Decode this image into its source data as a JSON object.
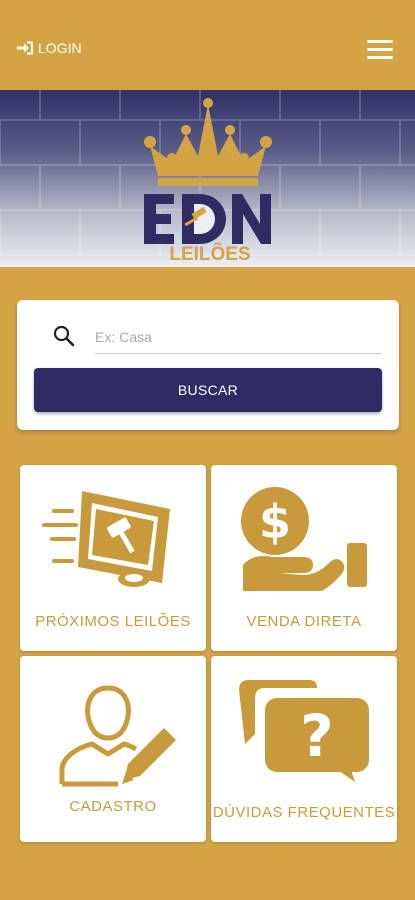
{
  "header": {
    "login_label": "LOGIN",
    "login_icon": "sign-in-icon",
    "menu_icon": "hamburger-menu-icon"
  },
  "banner": {
    "logo_letters": "EDN",
    "logo_subtitle": "LEILÕES"
  },
  "search": {
    "placeholder": "Ex: Casa",
    "value": "",
    "button_label": "BUSCAR"
  },
  "tiles": [
    {
      "label": "PRÓXIMOS LEILÕES",
      "icon": "auction-monitor-icon"
    },
    {
      "label": "VENDA DIRETA",
      "icon": "money-hand-icon"
    },
    {
      "label": "CADASTRO",
      "icon": "user-edit-icon"
    },
    {
      "label": "DÚVIDAS FREQUENTES",
      "icon": "question-bubbles-icon"
    }
  ],
  "colors": {
    "gold": "#d4a444",
    "navy": "#2e2c63",
    "tile_text": "#c99a3c"
  }
}
